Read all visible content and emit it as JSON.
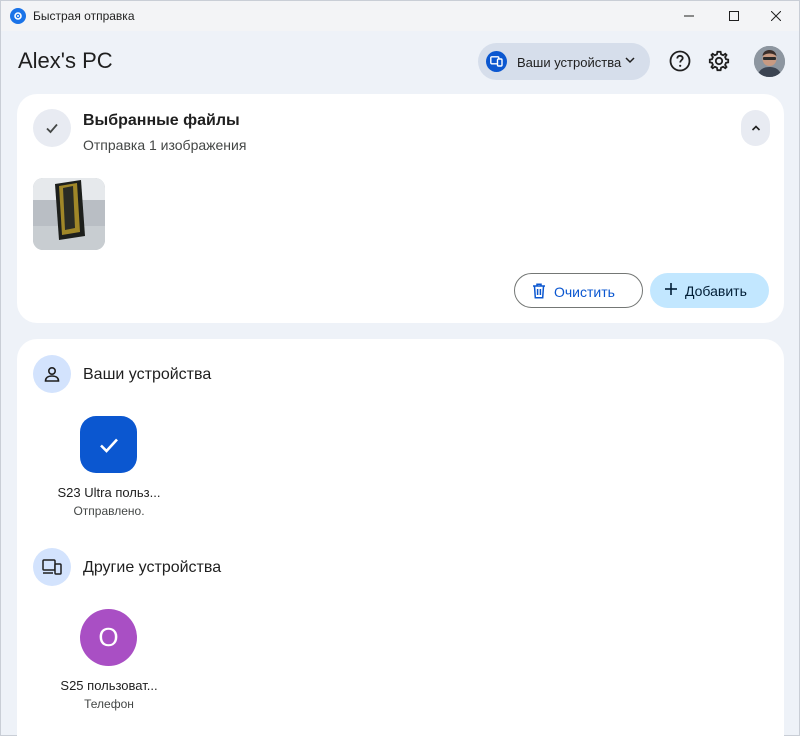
{
  "window": {
    "title": "Быстрая отправка"
  },
  "header": {
    "pc_name": "Alex's PC",
    "devices_dropdown_label": "Ваши устройства"
  },
  "selected_files": {
    "title": "Выбранные файлы",
    "subtitle": "Отправка 1 изображения",
    "clear_label": "Очистить",
    "add_label": "Добавить"
  },
  "your_devices": {
    "title": "Ваши устройства",
    "items": [
      {
        "name": "S23 Ultra польз...",
        "status": "Отправлено."
      }
    ]
  },
  "other_devices": {
    "title": "Другие устройства",
    "items": [
      {
        "name": "S25 пользоват...",
        "status": "Телефон",
        "initial": "O"
      }
    ]
  },
  "colors": {
    "accent": "#0b57d0",
    "pill_bg": "#d6deeb",
    "add_button_bg": "#c2e7ff",
    "avatar_purple": "#a94fc4"
  },
  "icons": [
    "quick-share-icon",
    "devices-icon",
    "chevron-down-icon",
    "help-icon",
    "gear-icon",
    "check-icon",
    "chevron-up-icon",
    "trash-icon",
    "plus-icon",
    "person-icon"
  ]
}
